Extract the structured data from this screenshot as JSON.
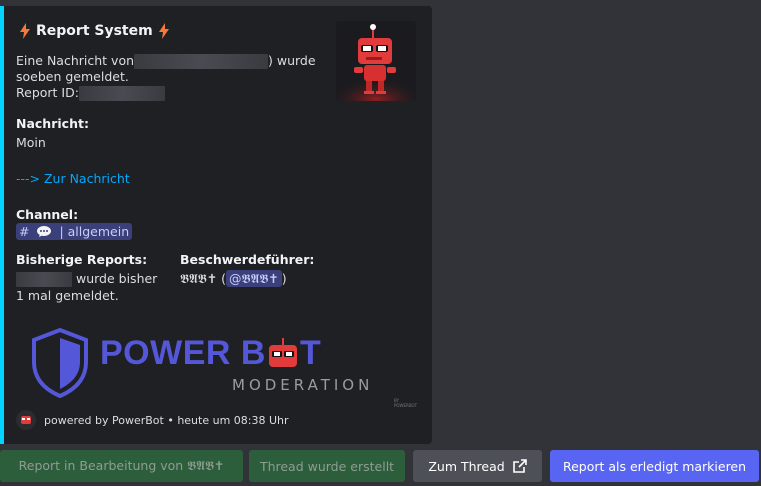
{
  "embed": {
    "title": "Report System",
    "desc_line1_prefix": "Eine Nachricht von",
    "desc_line1_suffix": ") wurde",
    "desc_line2": "soeben gemeldet.",
    "desc_line3": "Report ID:",
    "message_label": "Nachricht:",
    "message_value": "Moin",
    "link_text": "---> Zur Nachricht",
    "channel_label": "Channel:",
    "channel_hash": "#",
    "channel_name": "| allgemein",
    "previous_label": "Bisherige Reports:",
    "previous_suffix": "wurde bisher",
    "previous_line2": "1 mal gemeldet.",
    "complainant_label": "Beschwerdeführer:",
    "complainant_name": "𝕭𝕬𝕭✝",
    "complainant_mention": "@𝕭𝕬𝕭✝",
    "banner_text_power": "POWER B",
    "banner_text_t": "T",
    "banner_subtext": "MODERATION",
    "banner_tiny": "BY POWERBOT",
    "footer_text": "powered by PowerBot • heute um 08:38 Uhr"
  },
  "buttons": {
    "in_progress": "Report in Bearbeitung von 𝕭𝕬𝕭✝",
    "thread_created": "Thread wurde erstellt",
    "to_thread": "Zum Thread",
    "mark_done": "Report als erledigt markieren"
  },
  "colors": {
    "accent_bar": "#00d4ff",
    "link": "#00a8fc",
    "blurple": "#5865f2",
    "green": "#2c5e3c"
  }
}
